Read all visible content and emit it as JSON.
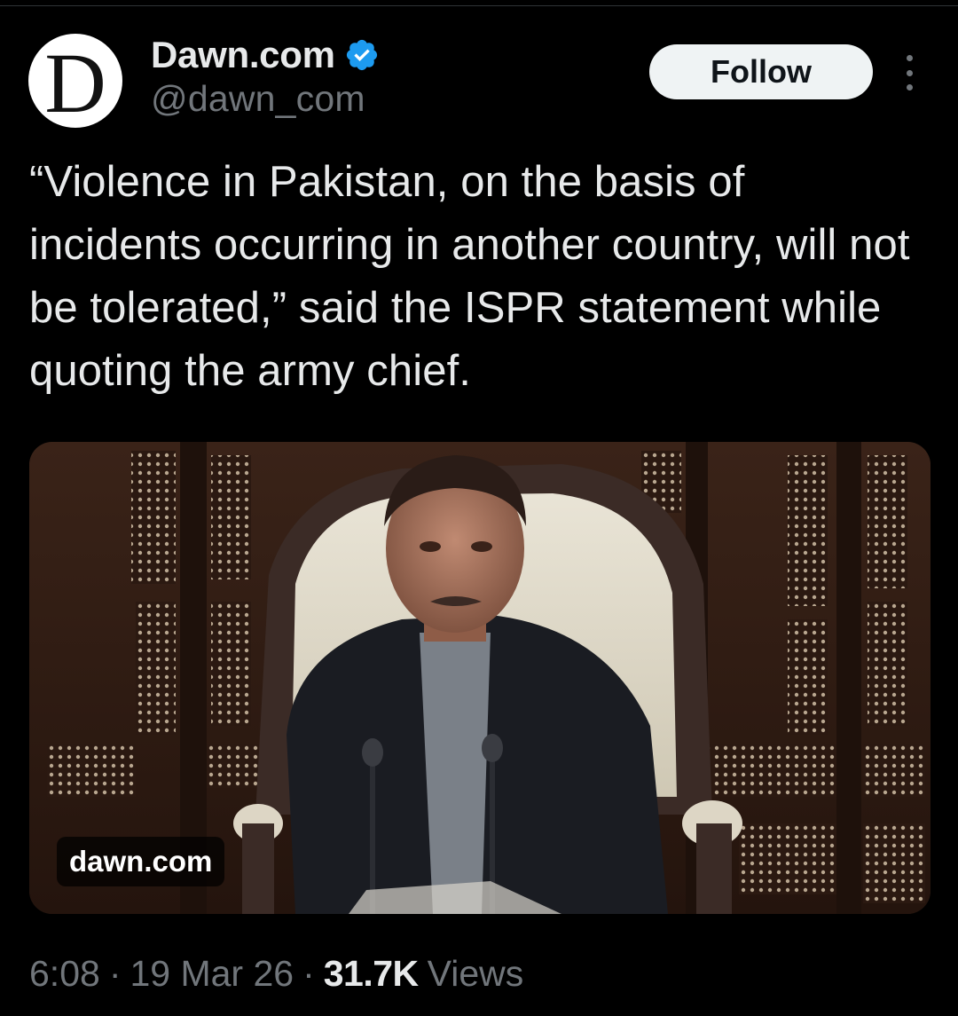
{
  "author": {
    "avatar_letter": "D",
    "display_name": "Dawn.com",
    "handle": "@dawn_com",
    "verified_color": "#1d9bf0"
  },
  "follow_label": "Follow",
  "tweet": {
    "text": "“Violence in Pakistan, on the basis of incidents occurring in another country, will not be tolerated,” said the ISPR statement while quoting the army chief."
  },
  "media": {
    "source_label": "dawn.com"
  },
  "meta": {
    "time": "6:08",
    "separator": "·",
    "date": "19 Mar 26",
    "views_count": "31.7K",
    "views_label": "Views"
  },
  "colors": {
    "background": "#000000",
    "text_primary": "#e7e9ea",
    "text_secondary": "#71767b",
    "button_bg": "#eff3f4",
    "verified_blue": "#1d9bf0"
  }
}
